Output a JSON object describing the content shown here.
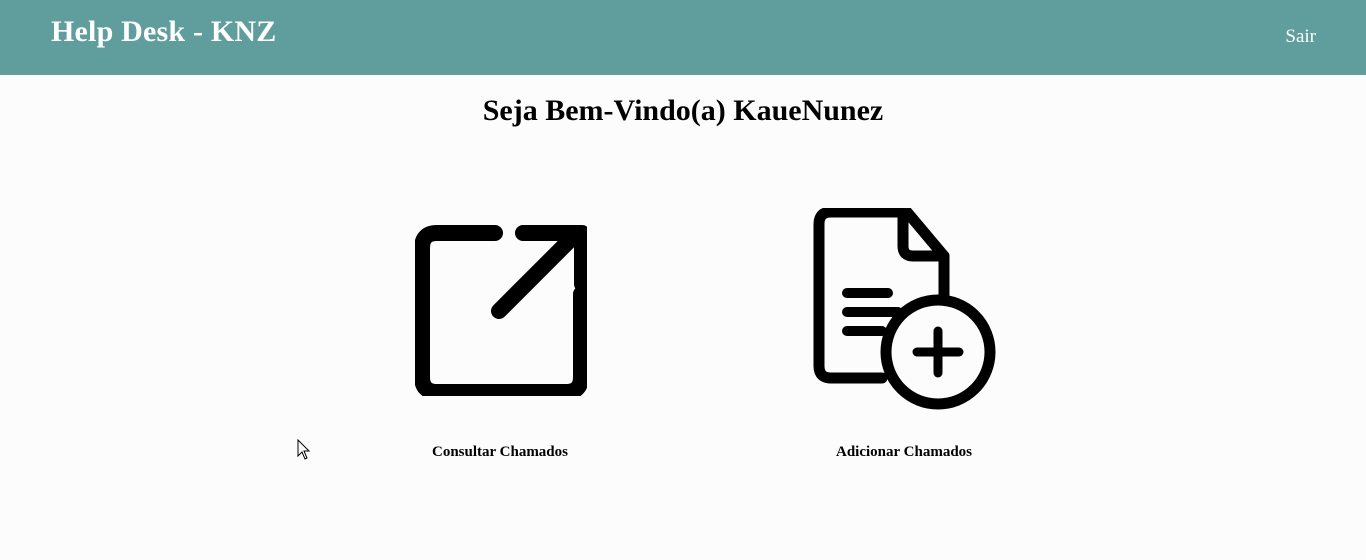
{
  "navbar": {
    "brand": "Help Desk - KNZ",
    "logout_label": "Sair",
    "background_color": "#5f9e9c"
  },
  "main": {
    "welcome": "Seja Bem-Vindo(a) KaueNunez",
    "cards": [
      {
        "label": "Consultar Chamados",
        "icon": "external-link-icon"
      },
      {
        "label": "Adicionar Chamados",
        "icon": "file-add-icon"
      }
    ]
  }
}
